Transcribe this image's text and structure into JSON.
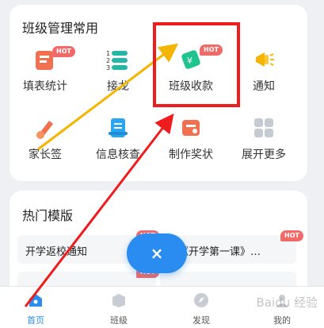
{
  "common_section": {
    "title": "班级管理常用",
    "items": [
      {
        "label": "填表统计",
        "icon": "form-icon",
        "hot": "HOT"
      },
      {
        "label": "接龙",
        "icon": "list-icon"
      },
      {
        "label": "班级收款",
        "icon": "payment-icon",
        "hot": "HOT"
      },
      {
        "label": "通知",
        "icon": "megaphone-icon"
      },
      {
        "label": "家长签",
        "icon": "sign-icon"
      },
      {
        "label": "信息核查",
        "icon": "clipboard-icon"
      },
      {
        "label": "制作奖状",
        "icon": "certificate-icon"
      },
      {
        "label": "展开更多",
        "icon": "grid-more-icon"
      }
    ]
  },
  "hot_section": {
    "title": "热门模版",
    "items": [
      {
        "label": "开学返校通知",
        "hot": "HOT"
      },
      {
        "label": "看《开学第一课》…",
        "hot": "HOT"
      },
      {
        "label": "",
        "hot": "HOT"
      }
    ]
  },
  "fab": {
    "label": "×"
  },
  "tabbar": {
    "tabs": [
      {
        "label": "首页",
        "icon": "home-icon",
        "active": true
      },
      {
        "label": "班级",
        "icon": "class-icon"
      },
      {
        "label": "发现",
        "icon": "discover-icon"
      },
      {
        "label": "我的",
        "icon": "profile-icon"
      }
    ]
  },
  "watermark": "Baidu 经验",
  "colors": {
    "accent": "#2a8cf0",
    "hot_badge": "#f06a6a",
    "highlight": "#ee1c1c",
    "arrow_yellow": "#f5b400"
  }
}
